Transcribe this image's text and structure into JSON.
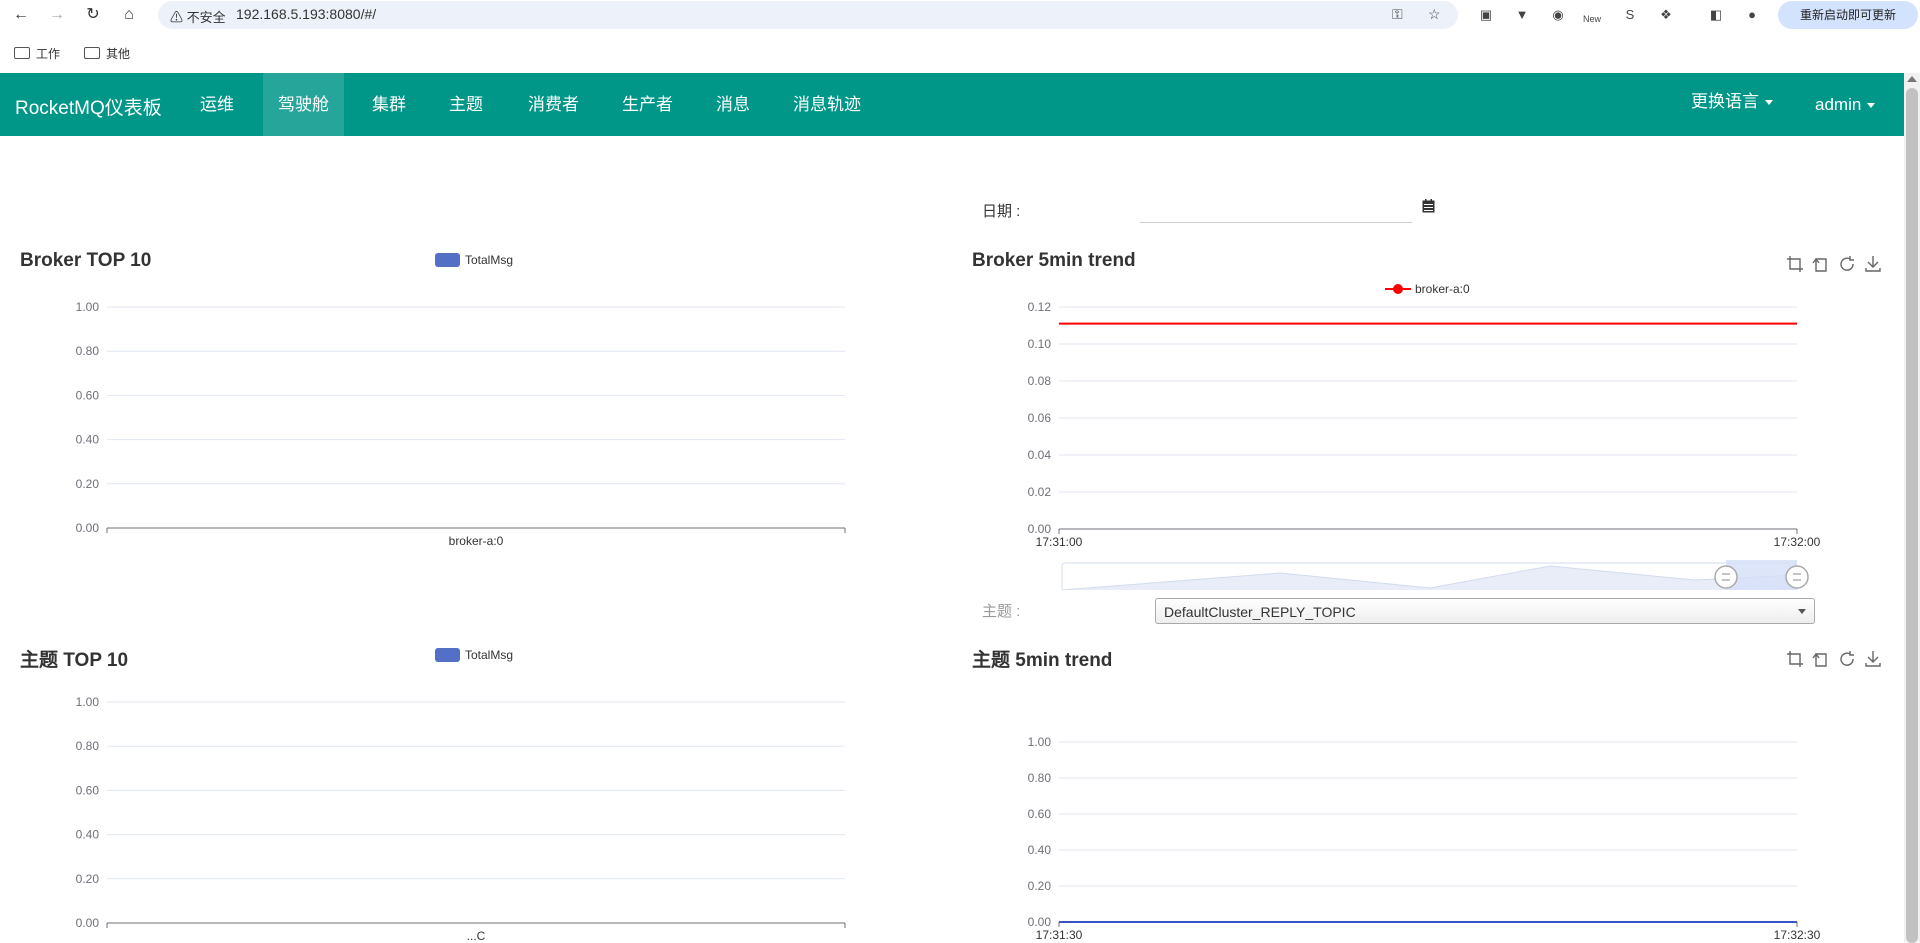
{
  "browser": {
    "security_label": "不安全",
    "url": "192.168.5.193:8080/#/",
    "update_button": "重新启动即可更新",
    "new_badge": "New",
    "bookmarks": [
      {
        "label": "工作"
      },
      {
        "label": "其他"
      }
    ]
  },
  "navbar": {
    "brand": "RocketMQ仪表板",
    "items": [
      {
        "label": "运维"
      },
      {
        "label": "驾驶舱",
        "active": true
      },
      {
        "label": "集群"
      },
      {
        "label": "主题"
      },
      {
        "label": "消费者"
      },
      {
        "label": "生产者"
      },
      {
        "label": "消息"
      },
      {
        "label": "消息轨迹"
      }
    ],
    "language_menu": "更换语言",
    "user_menu": "admin"
  },
  "dashboard": {
    "date_label": "日期 :",
    "date_value": "",
    "topic_label": "主题 :",
    "topic_selected": "DefaultCluster_REPLY_TOPIC"
  },
  "chart_data": [
    {
      "id": "broker_top10",
      "type": "bar",
      "title": "Broker TOP 10",
      "legend": [
        "TotalMsg"
      ],
      "categories": [
        "broker-a:0"
      ],
      "series": [
        {
          "name": "TotalMsg",
          "values": [
            0
          ]
        }
      ],
      "ylim": [
        0,
        1
      ],
      "yticks": [
        "1.00",
        "0.80",
        "0.60",
        "0.40",
        "0.20",
        "0.00"
      ],
      "color": "#5470c6"
    },
    {
      "id": "broker_5min_trend",
      "type": "line",
      "title": "Broker 5min trend",
      "legend": [
        "broker-a:0"
      ],
      "x": [
        "17:31:00",
        "17:32:00"
      ],
      "series": [
        {
          "name": "broker-a:0",
          "values": [
            0.111,
            0.111
          ]
        }
      ],
      "ylim": [
        0,
        0.12
      ],
      "yticks": [
        "0.12",
        "0.10",
        "0.08",
        "0.06",
        "0.04",
        "0.02",
        "0.00"
      ],
      "color": "#ff0000"
    },
    {
      "id": "topic_top10",
      "type": "bar",
      "title": "主题 TOP 10",
      "legend": [
        "TotalMsg"
      ],
      "categories": [
        "...C"
      ],
      "series": [
        {
          "name": "TotalMsg",
          "values": [
            0
          ]
        }
      ],
      "ylim": [
        0,
        1
      ],
      "yticks": [
        "1.00",
        "0.80",
        "0.60",
        "0.40",
        "0.20",
        "0.00"
      ],
      "color": "#5470c6"
    },
    {
      "id": "topic_5min_trend",
      "type": "line",
      "title": "主题 5min trend",
      "legend": [],
      "x": [
        "17:31:30",
        "17:32:30"
      ],
      "series": [
        {
          "values": [
            0,
            0
          ]
        }
      ],
      "ylim": [
        0,
        1
      ],
      "yticks": [
        "1.00",
        "0.80",
        "0.60",
        "0.40",
        "0.20",
        "0.00"
      ],
      "color": "#3a53c4"
    }
  ]
}
